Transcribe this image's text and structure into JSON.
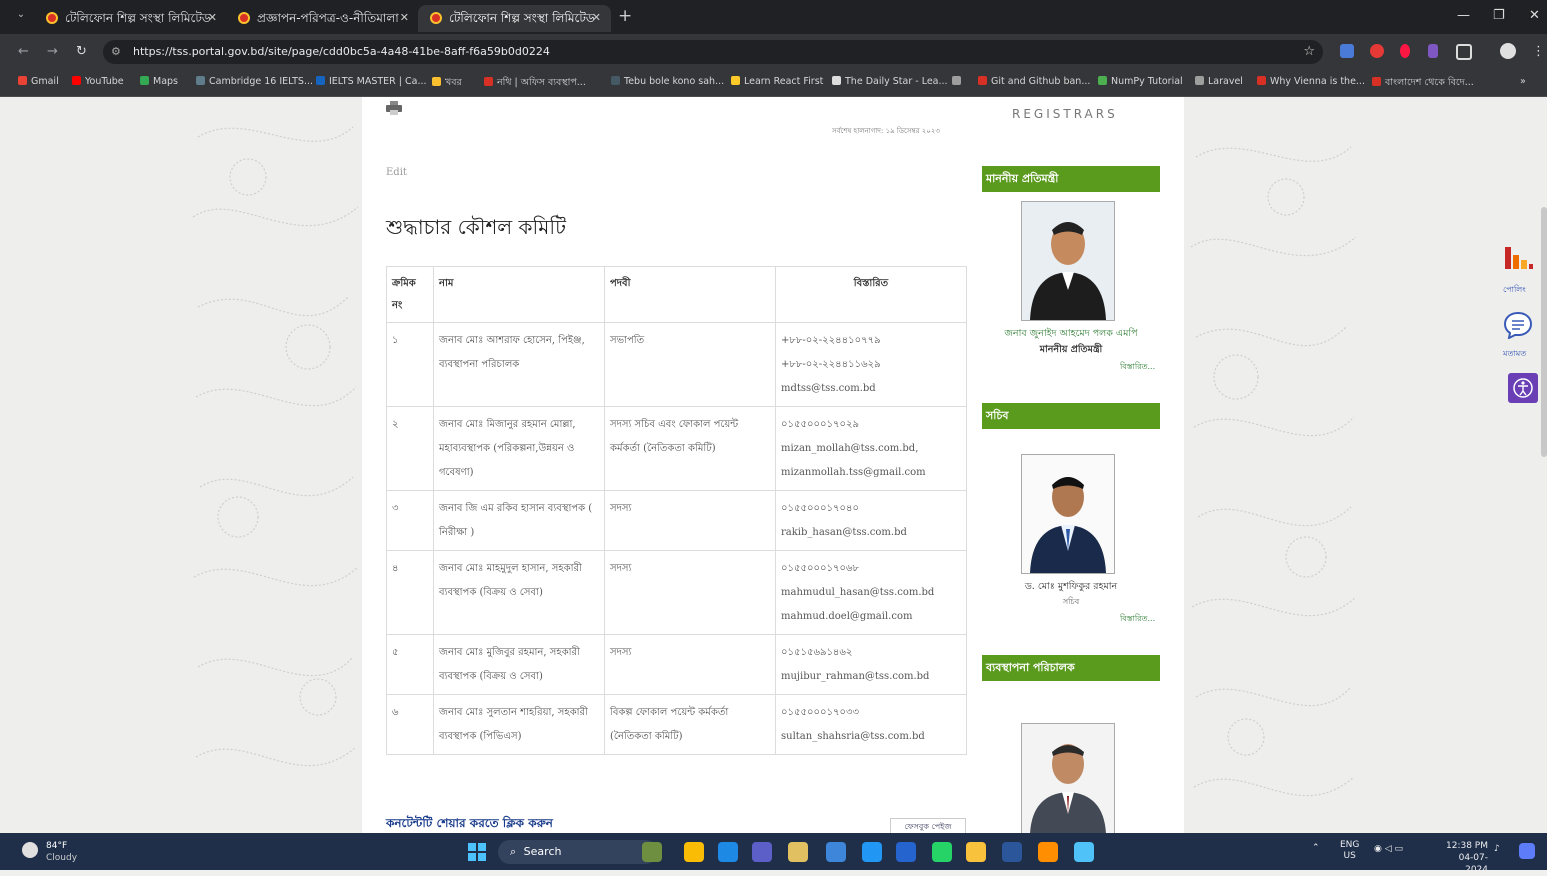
{
  "browser": {
    "tabs": [
      {
        "title": "টেলিফোন শিল্প সংস্থা লিমিটেড"
      },
      {
        "title": "প্রজ্ঞাপন-পরিপত্র-ও-নীতিমালা"
      },
      {
        "title": "টেলিফোন শিল্প সংস্থা লিমিটেড"
      }
    ],
    "url": "https://tss.portal.gov.bd/site/page/cdd0bc5a-4a48-41be-8aff-f6a59b0d0224",
    "bookmarks": [
      "Gmail",
      "YouTube",
      "Maps",
      "Cambridge 16 IELTS...",
      "IELTS MASTER | Ca...",
      "খবর",
      "নথি | অফিস ব্যবস্থাপ...",
      "Tebu bole kono sah...",
      "Learn React First",
      "The Daily Star - Lea...",
      "",
      "Git and Github ban...",
      "NumPy Tutorial",
      "Laravel",
      "Why Vienna is the...",
      "বাংলাদেশ থেকে বিদে..."
    ],
    "bookmark_colors": [
      "#ea4335",
      "#ff0000",
      "#34a853",
      "#607d8b",
      "#1565c0",
      "#fbc02d",
      "#d93025",
      "#455a64",
      "#ffca28",
      "#dddddd",
      "#9e9e9e",
      "#d93025",
      "#4caf50",
      "#9e9e9e",
      "#d93025",
      "#d93025"
    ]
  },
  "page": {
    "updated": "সর্বশেষ হালনাগাদ: ১৯ ডিসেম্বর ২০২৩",
    "edit_label": "Edit",
    "title": "শুদ্ধাচার কৌশল কমিটি",
    "table": {
      "headers": {
        "serial": "ক্রমিক নং",
        "name": "নাম",
        "designation": "পদবী",
        "details": "বিস্তারিত"
      },
      "rows": [
        {
          "serial": "১",
          "name": "জনাব মোঃ আশরাফ হোসেন, পিইঞ্জ, ব্যবস্থাপনা পরিচালক",
          "designation": "সভাপতি",
          "details": "+৮৮-০২-২২৪৪১০৭৭৯\n+৮৮-০২-২২৪৪১১৬২৯\nmdtss@tss.com.bd"
        },
        {
          "serial": "২",
          "name": "জনাব মোঃ মিজানুর রহমান মোল্লা, মহাব্যবস্থাপক (পরিকল্পনা,উন্নয়ন ও গবেষণা)",
          "designation": "সদস্য সচিব এবং ফোকাল পয়েন্ট কর্মকর্তা (নৈতিকতা কমিটি)",
          "details": "০১৫৫০০০১৭০২৯\nmizan_mollah@tss.com.bd,\nmizanmollah.tss@gmail.com"
        },
        {
          "serial": "৩",
          "name": "জনাব জি এম রকিব হাসান ব্যবস্থাপক ( নিরীক্ষা )",
          "designation": "সদস্য",
          "details": "০১৫৫০০০১৭০৪০\nrakib_hasan@tss.com.bd"
        },
        {
          "serial": "৪",
          "name": "জনাব মোঃ মাহমুদুল হাসান, সহকারী ব্যবস্থাপক (বিক্রয় ও সেবা)",
          "designation": "সদস্য",
          "details": "০১৫৫০০০১৭০৬৮\nmahmudul_hasan@tss.com.bd\nmahmud.doel@gmail.com"
        },
        {
          "serial": "৫",
          "name": "জনাব মোঃ মুজিবুর রহমান, সহকারী ব্যবস্থাপক (বিক্রয় ও সেবা)",
          "designation": "সদস্য",
          "details": "০১৫১৫৬৯১৪৬২\nmujibur_rahman@tss.com.bd"
        },
        {
          "serial": "৬",
          "name": "জনাব মোঃ সুলতান শাহরিয়া, সহকারী ব্যবস্থাপক (পিভিএস)",
          "designation": "বিকল্প ফোকাল পয়েন্ট কর্মকর্তা (নৈতিকতা কমিটি)",
          "details": "০১৫৫০০০১৭০৩৩\nsultan_shahsria@tss.com.bd"
        }
      ]
    },
    "share_text": "কনটেন্টটি শেয়ার করতে ক্লিক করুন",
    "share_button": "ফেসবুক পেইজ"
  },
  "sidebar": {
    "logo_text": "REGISTRARS",
    "minister": {
      "heading": "মাননীয় প্রতিমন্ত্রী",
      "name": "জনাব জুনাইদ আহমেদ পলক এমপি",
      "role": "মাননীয় প্রতিমন্ত্রী",
      "more": "বিস্তারিত..."
    },
    "secretary": {
      "heading": "সচিব",
      "name": "ড. মোঃ মুশফিকুর রহমান",
      "role": "সচিব",
      "more": "বিস্তারিত..."
    },
    "md": {
      "heading": "ব্যবস্থাপনা পরিচালক"
    }
  },
  "floating": {
    "poll_label": "পোলিং",
    "feedback_label": "মতামত"
  },
  "taskbar": {
    "weather_temp": "84°F",
    "weather_text": "Cloudy",
    "search": "Search",
    "lang1": "ENG",
    "lang2": "US",
    "time": "12:38 PM",
    "date": "04-07-2024"
  },
  "colors": {
    "accent_green": "#5a9a1c",
    "chrome_dark": "#202124"
  }
}
